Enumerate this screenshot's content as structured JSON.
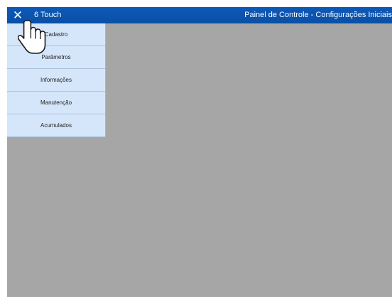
{
  "topbar": {
    "close_glyph": "✕",
    "app_title": "6 Touch",
    "page_title": "Painel de Controle - Configurações Iniciais"
  },
  "menu": {
    "items": [
      {
        "label": "Cadastro"
      },
      {
        "label": "Parâmetros"
      },
      {
        "label": "Informações"
      },
      {
        "label": "Manutenção"
      },
      {
        "label": "Acumulados"
      }
    ]
  },
  "cursor": {
    "icon": "hand-pointer-icon"
  },
  "colors": {
    "topbar": "#0a4fa6",
    "menu_background": "#d5e6fb",
    "content_background": "#a6a6a6"
  }
}
